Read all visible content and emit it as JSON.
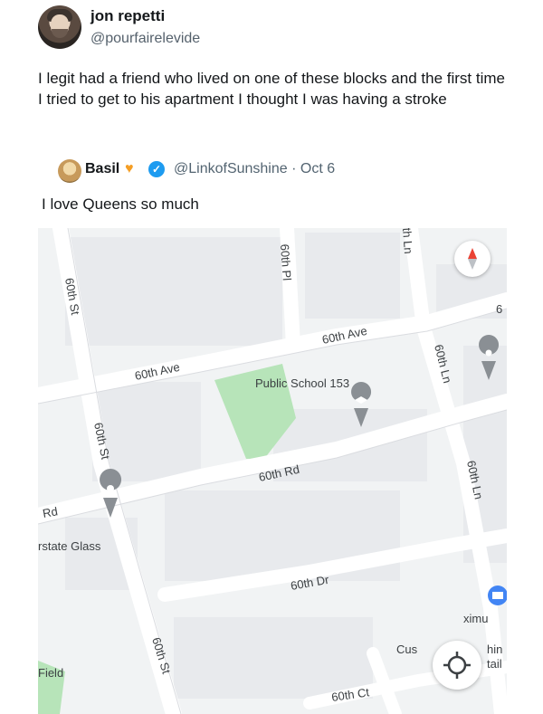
{
  "tweet": {
    "name": "jon repetti",
    "handle": "@pourfairelevide",
    "text": "I legit had a friend who lived on one of these blocks and the first time I tried to get to his apartment I thought I was having a stroke"
  },
  "quote": {
    "name": "Basil",
    "heart": "♥",
    "verified": "✓",
    "handle_date": "@LinkofSunshine · Oct 6",
    "text": "I love Queens so much"
  },
  "map": {
    "labels": {
      "st_left_top": "60th St",
      "pl_top": "60th Pl",
      "ln_top_partial": "th Ln",
      "ave_upper": "60th Ave",
      "ave_left": "60th Ave",
      "school": "Public School 153",
      "ln_right_upper": "60th Ln",
      "st_mid": "60th St",
      "rd": "60th Rd",
      "rd_left": "Rd",
      "ln_right_lower": "60th Ln",
      "glass": "rstate Glass",
      "dr": "60th Dr",
      "field": "Field",
      "st_bottom": "60th St",
      "ct": "60th Ct",
      "cust": "Cus",
      "ximu": "ximu",
      "hin": "hin",
      "tail": "tail",
      "edge_6": "6"
    },
    "colors": {
      "road": "#ffffff",
      "block": "#f1f3f4",
      "building": "#e8eaed",
      "park": "#b7e4b9",
      "pin": "#70757a"
    }
  }
}
